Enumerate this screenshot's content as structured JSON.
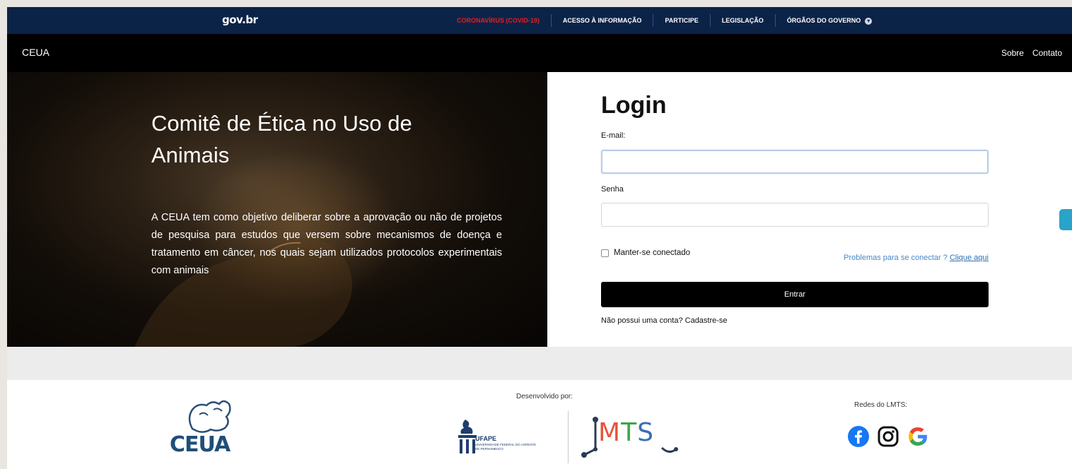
{
  "govbar": {
    "logo": "gov.br",
    "items": [
      {
        "label": "CORONAVÍRUS (COVID-19)"
      },
      {
        "label": "ACESSO À INFORMAÇÃO"
      },
      {
        "label": "PARTICIPE"
      },
      {
        "label": "LEGISLAÇÃO"
      },
      {
        "label": "ÓRGÃOS DO GOVERNO"
      }
    ],
    "alert_color": "#e02020"
  },
  "appnav": {
    "brand": "CEUA",
    "links": [
      {
        "label": "Sobre"
      },
      {
        "label": "Contato"
      }
    ]
  },
  "hero": {
    "title": "Comitê de Ética no Uso de Animais",
    "description": "A CEUA tem como objetivo deliberar sobre a aprovação ou não de projetos de pesquisa para estudos que versem sobre mecanismos de doença e tratamento em câncer, nos quais sejam utilizados protocolos experimentais com animais"
  },
  "login": {
    "title": "Login",
    "email_label": "E-mail:",
    "email_value": "",
    "password_label": "Senha",
    "password_value": "",
    "remember_label": "Manter-se conectado",
    "remember_checked": false,
    "help_text": "Problemas para se conectar ?",
    "help_link": "Clique aqui",
    "submit_label": "Entrar",
    "signup_text": "Não possui uma conta? Cadastre-se"
  },
  "footer": {
    "ceua_logo_text": "CEUA",
    "developed_by": "Desenvolvido por:",
    "ufape_name": "UFAPE",
    "ufape_subtitle": "UNIVERSIDADE FEDERAL DO AGRESTE DE PERNAMBUCO",
    "lmts_name": "LMTS",
    "social_label": "Redes do LMTS:",
    "social_icons": [
      "facebook-icon",
      "instagram-icon",
      "google-icon"
    ]
  },
  "colors": {
    "gov_blue": "#0c2348",
    "link_blue": "#2d6fb5",
    "facebook": "#1877f2",
    "lmts_blue": "#3a6fb5"
  }
}
